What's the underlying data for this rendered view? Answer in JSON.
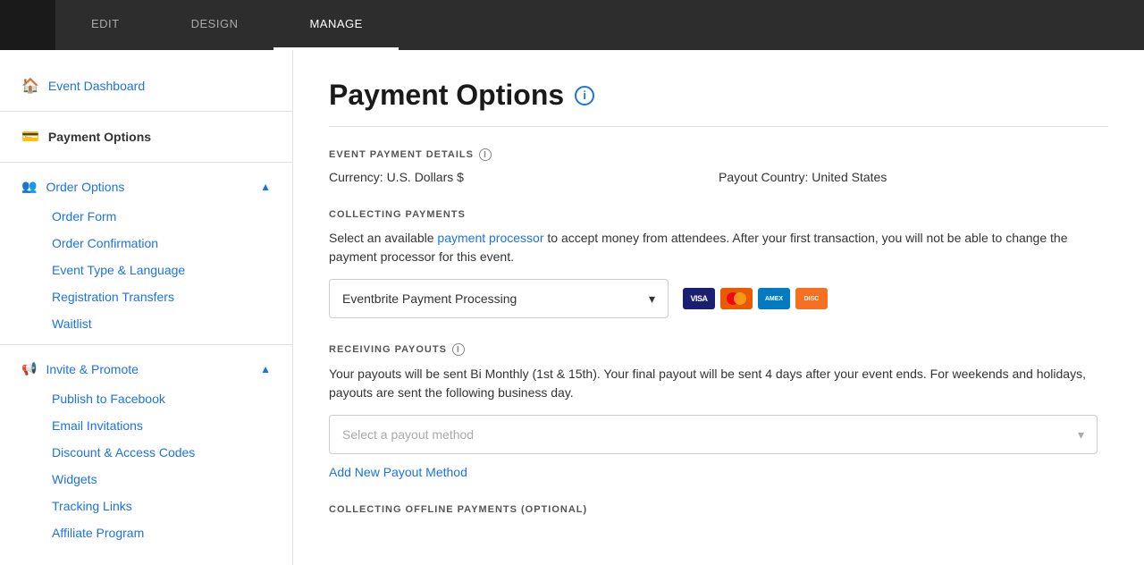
{
  "topNav": {
    "tabs": [
      {
        "label": "EDIT",
        "active": false
      },
      {
        "label": "DESIGN",
        "active": false
      },
      {
        "label": "MANAGE",
        "active": true
      }
    ]
  },
  "sidebar": {
    "eventDashboard": "Event Dashboard",
    "paymentOptions": "Payment Options",
    "orderOptions": {
      "label": "Order Options",
      "items": [
        "Order Form",
        "Order Confirmation",
        "Event Type & Language",
        "Registration Transfers",
        "Waitlist"
      ]
    },
    "invitePromote": {
      "label": "Invite & Promote",
      "items": [
        "Publish to Facebook",
        "Email Invitations",
        "Discount & Access Codes",
        "Widgets",
        "Tracking Links",
        "Affiliate Program"
      ]
    }
  },
  "content": {
    "pageTitle": "Payment Options",
    "sections": {
      "eventPaymentDetails": {
        "title": "EVENT PAYMENT DETAILS",
        "currency": "Currency: U.S. Dollars $",
        "payoutCountry": "Payout Country: United States"
      },
      "collectingPayments": {
        "title": "COLLECTING PAYMENTS",
        "description1": "Select an available ",
        "link": "payment processor",
        "description2": " to accept money from attendees. After your first transaction, you will not be able to change the payment processor for this event.",
        "dropdown": "Eventbrite Payment Processing",
        "cards": [
          "VISA",
          "MC",
          "AMEX",
          "DISC"
        ]
      },
      "receivingPayouts": {
        "title": "RECEIVING PAYOUTS",
        "description": "Your payouts will be sent Bi Monthly (1st & 15th). Your final payout will be sent 4 days after your event ends. For weekends and holidays, payouts are sent the following business day.",
        "dropdownPlaceholder": "Select a payout method",
        "addLink": "Add New Payout Method"
      },
      "collectingOffline": {
        "title": "COLLECTING OFFLINE PAYMENTS (OPTIONAL)"
      }
    }
  }
}
